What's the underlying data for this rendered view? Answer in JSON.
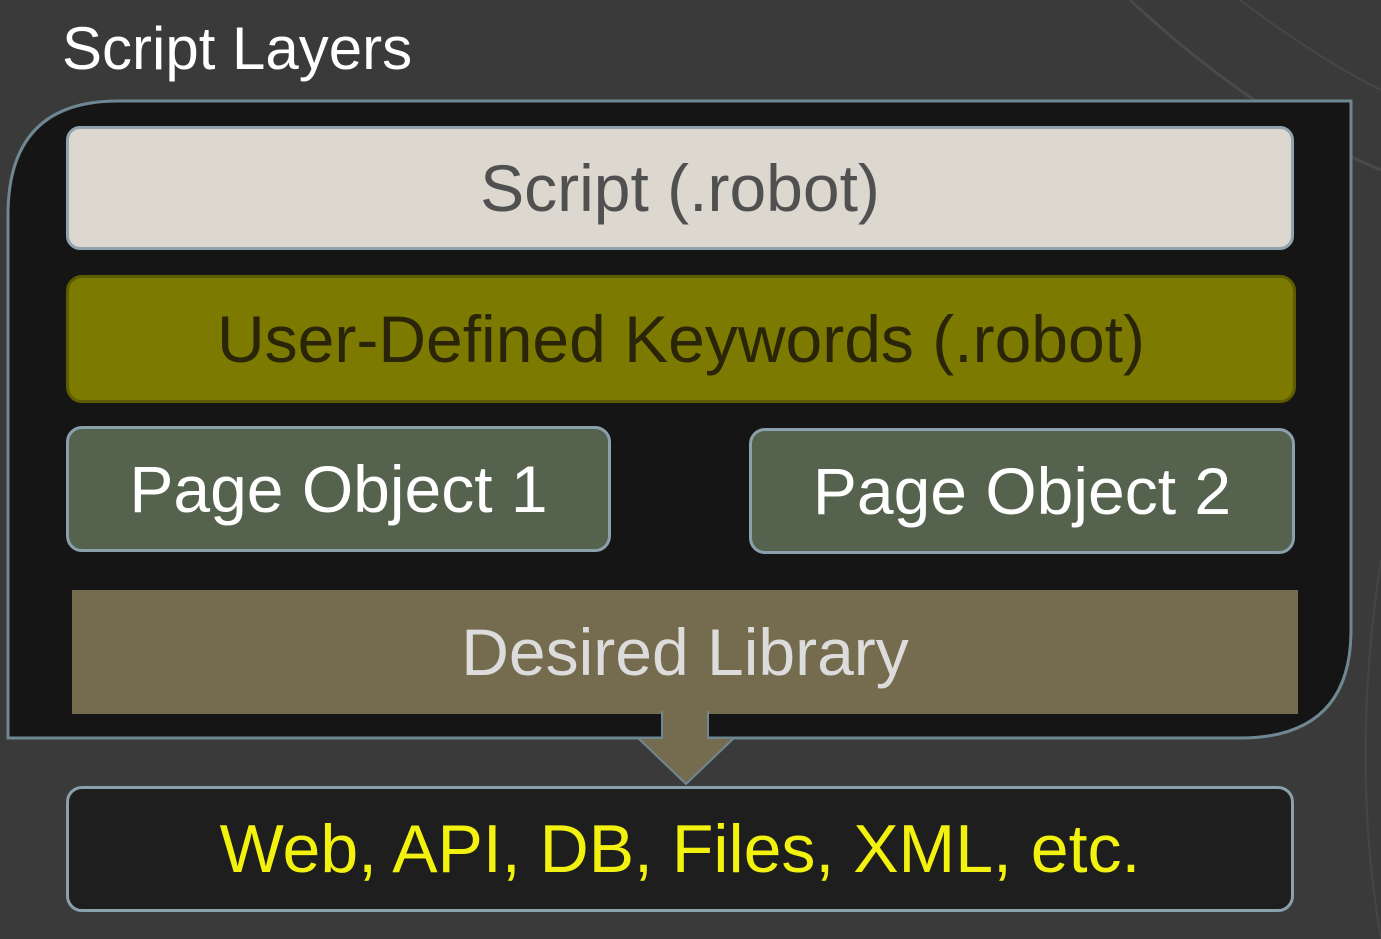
{
  "title": "Script Layers",
  "layers": {
    "script": "Script (.robot)",
    "user_keywords": "User-Defined Keywords (.robot)",
    "page_object_1": "Page Object 1",
    "page_object_2": "Page Object 2",
    "library": "Desired Library",
    "targets": "Web, API, DB, Files, XML, etc."
  },
  "colors": {
    "background": "#3a3a3a",
    "frame": "#151515",
    "script_box": "#dcd8cf",
    "keywords_box": "#7c7a00",
    "page_object_box": "#55624e",
    "library_box": "#756b4f",
    "targets_text": "#f2f20e"
  }
}
